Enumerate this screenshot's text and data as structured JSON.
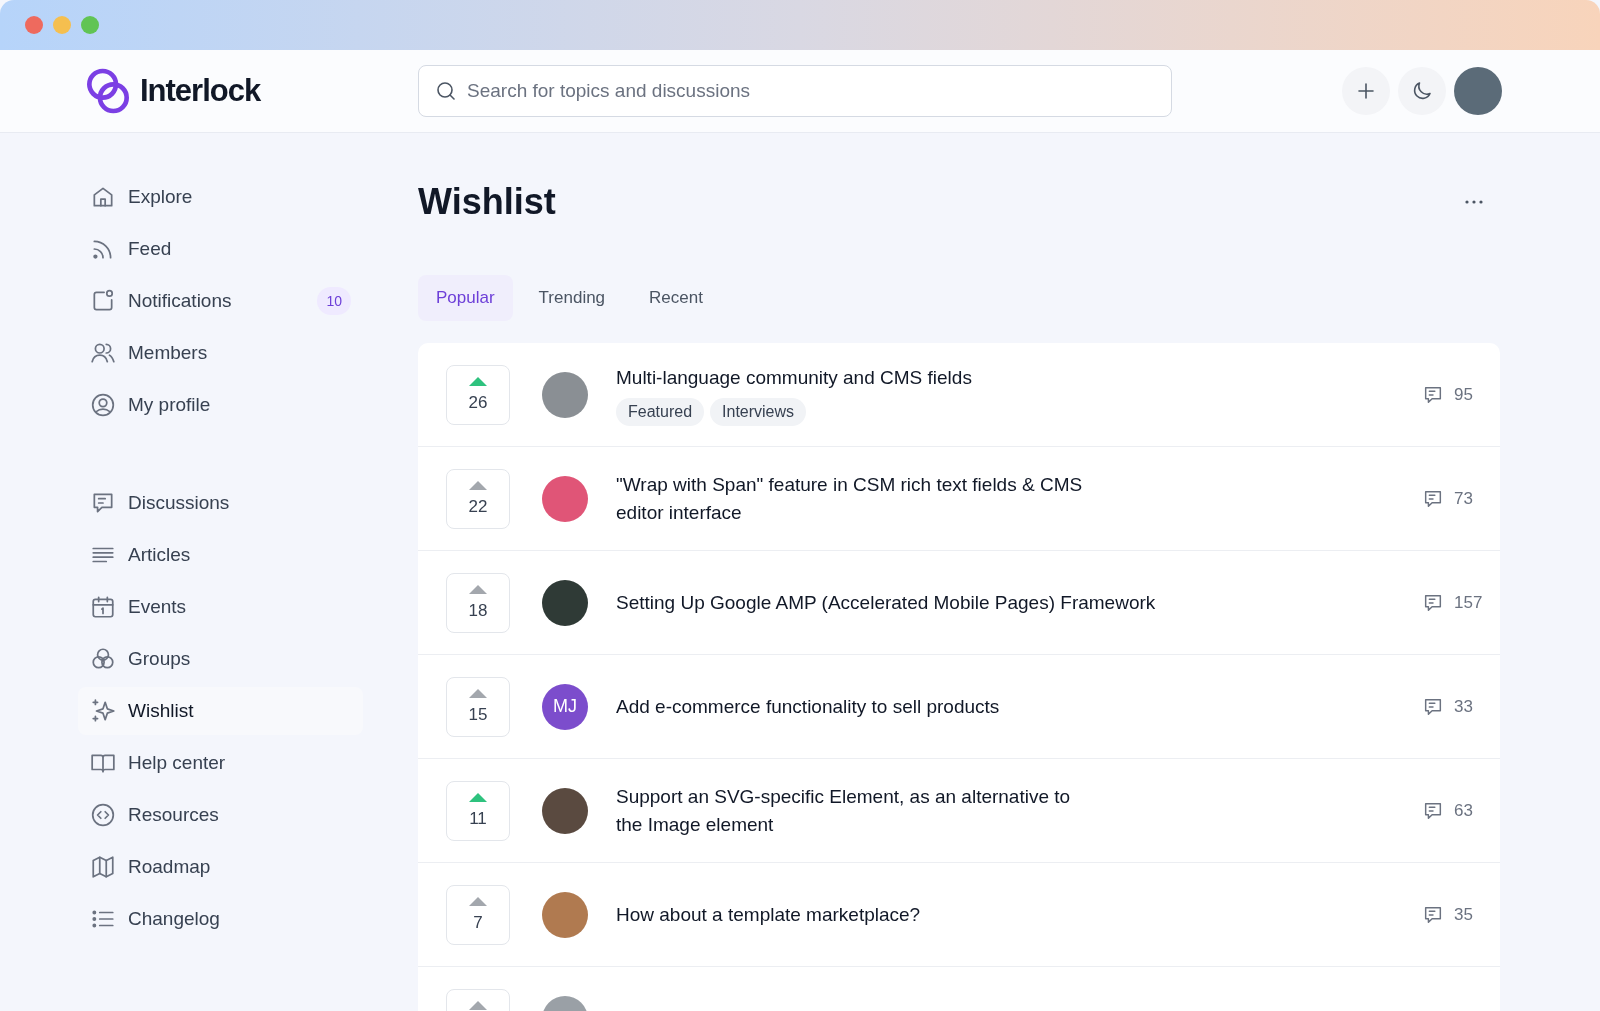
{
  "header": {
    "logo": "Interlock",
    "search": {
      "placeholder": "Search for topics and discussions"
    },
    "actions": [
      {
        "kind": "add"
      },
      {
        "kind": "theme"
      }
    ],
    "avatar": {
      "kind": "photo"
    }
  },
  "sidebar": {
    "groups": [
      [
        {
          "label": "Explore",
          "selected": false
        },
        {
          "label": "Feed",
          "selected": false
        },
        {
          "label": "Notifications",
          "selected": false,
          "badge": "10"
        },
        {
          "label": "Members",
          "selected": false
        },
        {
          "label": "My profile",
          "selected": false
        }
      ],
      [
        {
          "label": "Discussions",
          "selected": false
        },
        {
          "label": "Articles",
          "selected": false
        },
        {
          "label": "Events",
          "selected": false
        },
        {
          "label": "Groups",
          "selected": false
        },
        {
          "label": "Wishlist",
          "selected": true
        },
        {
          "label": "Help center",
          "selected": false
        },
        {
          "label": "Resources",
          "selected": false
        },
        {
          "label": "Roadmap",
          "selected": false
        },
        {
          "label": "Changelog",
          "selected": false
        }
      ]
    ]
  },
  "page": {
    "title": "Wishlist",
    "tabs": [
      {
        "label": "Popular",
        "selected": true
      },
      {
        "label": "Trending",
        "selected": false
      },
      {
        "label": "Recent",
        "selected": false
      }
    ]
  },
  "posts": [
    {
      "votes": "26",
      "voted": true,
      "avatar": {
        "kind": "photo",
        "color": "#8a8f94"
      },
      "title": "Multi-language community and CMS fields",
      "tags": [
        "Featured",
        "Interviews"
      ],
      "comments": "95"
    },
    {
      "votes": "22",
      "voted": false,
      "avatar": {
        "kind": "photo",
        "color": "#e05577"
      },
      "title": "\"Wrap with Span\" feature in CSM rich text fields & CMS editor interface",
      "comments": "73"
    },
    {
      "votes": "18",
      "voted": false,
      "avatar": {
        "kind": "photo",
        "color": "#2f3a36"
      },
      "title": "Setting Up Google AMP (Accelerated Mobile Pages) Framework",
      "comments": "157"
    },
    {
      "votes": "15",
      "voted": false,
      "avatar": {
        "kind": "initials",
        "initials": "MJ",
        "color": "#7c4dcc"
      },
      "title": "Add e-commerce functionality to sell products",
      "comments": "33"
    },
    {
      "votes": "11",
      "voted": true,
      "avatar": {
        "kind": "photo",
        "color": "#5a4a40"
      },
      "title": "Support an SVG-specific Element, as an alternative to the Image element",
      "comments": "63"
    },
    {
      "votes": "7",
      "voted": false,
      "avatar": {
        "kind": "photo",
        "color": "#b07a50"
      },
      "title": "How about a template marketplace?",
      "comments": "35"
    },
    {
      "voted": false,
      "avatar": {
        "kind": "photo",
        "color": "#9aa0a6"
      }
    }
  ]
}
